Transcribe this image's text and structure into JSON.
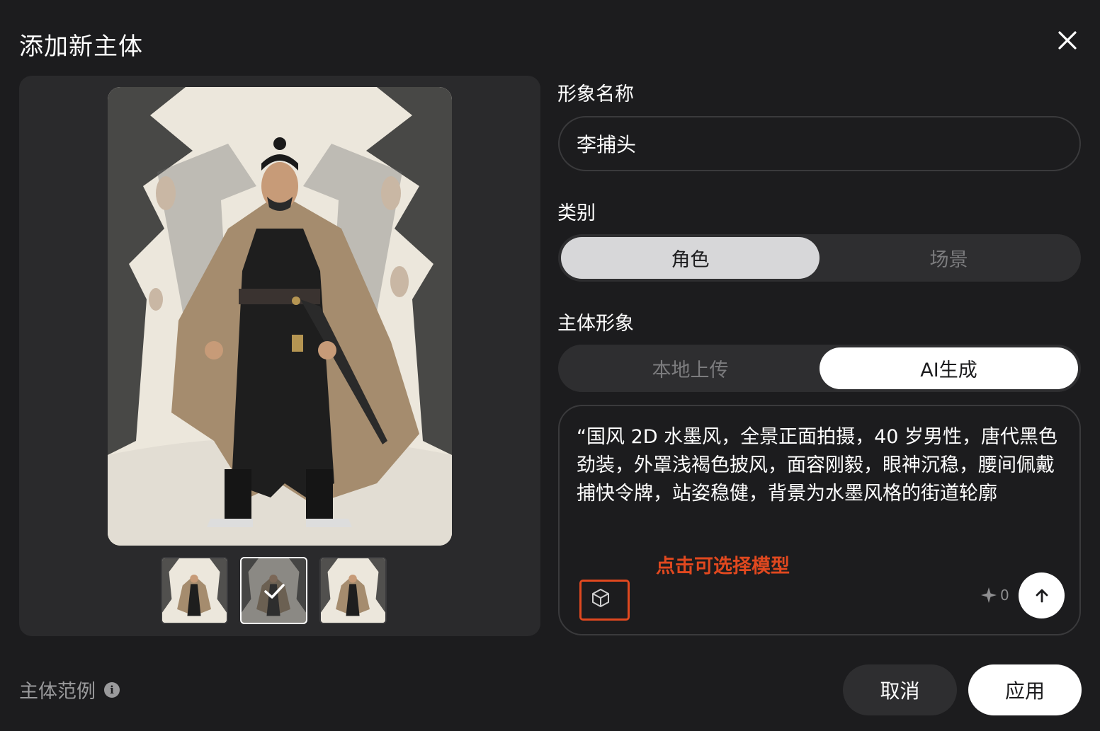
{
  "dialog": {
    "title": "添加新主体",
    "close_icon": "close-icon"
  },
  "preview": {
    "main_image": "ink-wash-constable-portrait",
    "thumbnails": [
      {
        "image": "constable-variant-1",
        "selected": false
      },
      {
        "image": "constable-variant-2",
        "selected": true
      },
      {
        "image": "constable-variant-3",
        "selected": false
      }
    ]
  },
  "form": {
    "name_label": "形象名称",
    "name_value": "李捕头",
    "category_label": "类别",
    "category_options": [
      "角色",
      "场景"
    ],
    "category_selected": "角色",
    "subject_label": "主体形象",
    "subject_options": [
      "本地上传",
      "AI生成"
    ],
    "subject_selected": "AI生成",
    "prompt_text": "“国风 2D 水墨风，全景正面拍摄，40 岁男性，唐代黑色劲装，外罩浅褐色披风，面容刚毅，眼神沉稳，腰间佩戴捕快令牌，站姿稳健，背景为水墨风格的街道轮廓",
    "model_hint": "点击可选择模型",
    "credits": "0"
  },
  "footer": {
    "examples_label": "主体范例",
    "cancel_label": "取消",
    "apply_label": "应用"
  },
  "colors": {
    "background": "#1c1c1e",
    "panel": "#2a2a2c",
    "accent_red": "#e0481f"
  }
}
